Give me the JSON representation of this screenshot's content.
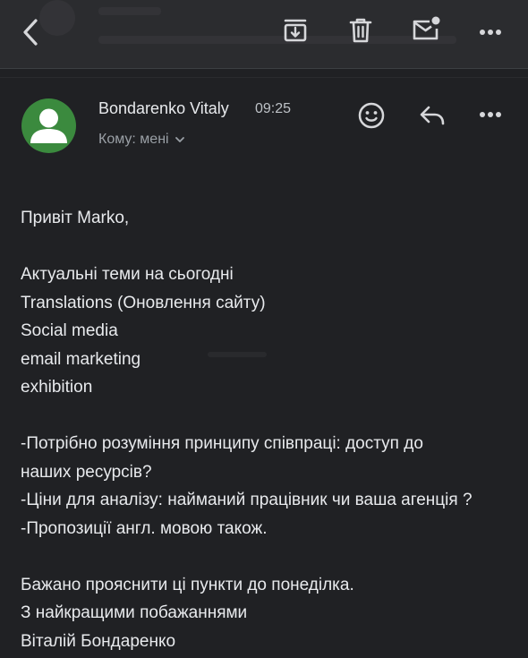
{
  "toolbar": {
    "back_icon": "chevron-left-icon",
    "archive_icon": "archive-icon",
    "delete_icon": "trash-icon",
    "mark_unread_icon": "mail-unread-icon",
    "more_icon": "more-horizontal-icon"
  },
  "email": {
    "sender_name": "Bondarenko Vitaly",
    "time": "09:25",
    "recipient_line": "Кому: мені",
    "actions": {
      "emoji_icon": "emoji-icon",
      "reply_icon": "reply-icon",
      "more_icon": "more-horizontal-icon"
    },
    "avatar_color": "#3b8a3e",
    "body": {
      "greeting": "Привіт Marko,",
      "topics_intro": "Актуальні теми на сьогодні",
      "topics": [
        "Translations (Оновлення сайту)",
        "Social media",
        "email marketing",
        "exhibition"
      ],
      "questions": [
        "-Потрібно розуміння принципу співпраці: доступ до",
        "наших ресурсів?",
        "-Ціни для аналізу: найманий працівник чи ваша агенція ?",
        "-Пропозиції англ. мовою також."
      ],
      "closing": [
        "Бажано прояснити ці пункти до понеділка.",
        "З найкращими побажаннями",
        "Віталій Бондаренко"
      ]
    }
  },
  "colors": {
    "background": "#202124",
    "toolbar": "#2b2c2f",
    "text": "#e8eaed",
    "secondary_text": "#9aa0a6"
  }
}
